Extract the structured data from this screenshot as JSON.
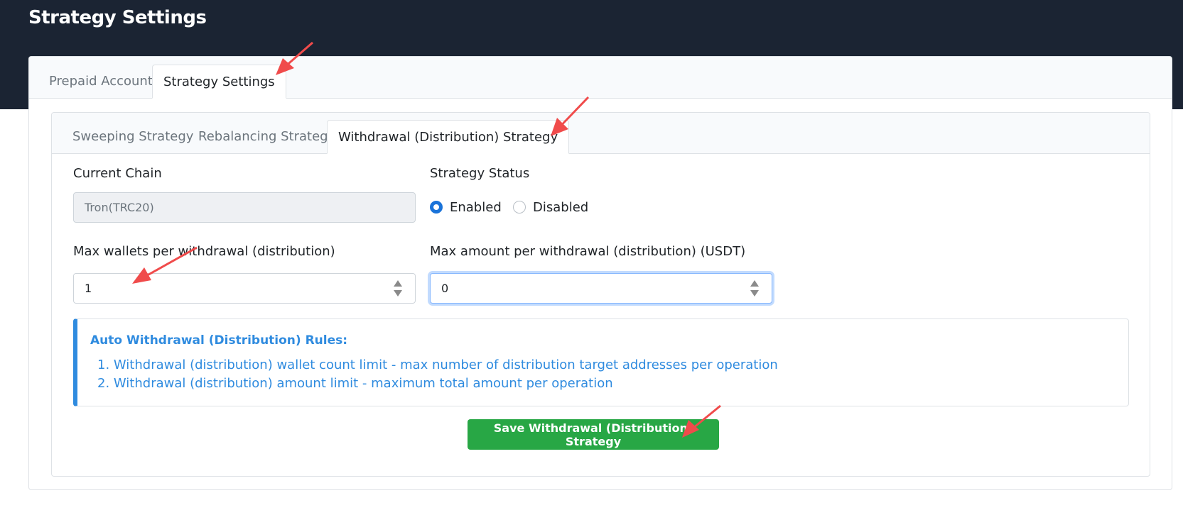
{
  "page": {
    "title": "Strategy Settings"
  },
  "main_tabs": [
    {
      "label": "Prepaid Account",
      "active": false
    },
    {
      "label": "Strategy Settings",
      "active": true
    }
  ],
  "strategy_tabs": [
    {
      "label": "Sweeping Strategy",
      "active": false
    },
    {
      "label": "Rebalancing Strategy",
      "active": false
    },
    {
      "label": "Withdrawal (Distribution) Strategy",
      "active": true
    }
  ],
  "form": {
    "current_chain": {
      "label": "Current Chain",
      "value": "Tron(TRC20)"
    },
    "strategy_status": {
      "label": "Strategy Status",
      "options": [
        {
          "label": "Enabled",
          "checked": true
        },
        {
          "label": "Disabled",
          "checked": false
        }
      ]
    },
    "max_wallets": {
      "label": "Max wallets per withdrawal (distribution)",
      "value": "1"
    },
    "max_amount": {
      "label": "Max amount per withdrawal (distribution) (USDT)",
      "value": "0"
    }
  },
  "rules": {
    "title": "Auto Withdrawal (Distribution) Rules:",
    "items": [
      "1. Withdrawal (distribution) wallet count limit - max number of distribution target addresses per operation",
      "2. Withdrawal (distribution) amount limit - maximum total amount per operation"
    ]
  },
  "save_button": {
    "label": "Save Withdrawal (Distribution) Strategy"
  },
  "colors": {
    "header_bg": "#1b2433",
    "accent_blue": "#2f8bdf",
    "radio_blue": "#1a73d9",
    "save_green": "#28a745",
    "annotation_red": "#f04b4b"
  }
}
